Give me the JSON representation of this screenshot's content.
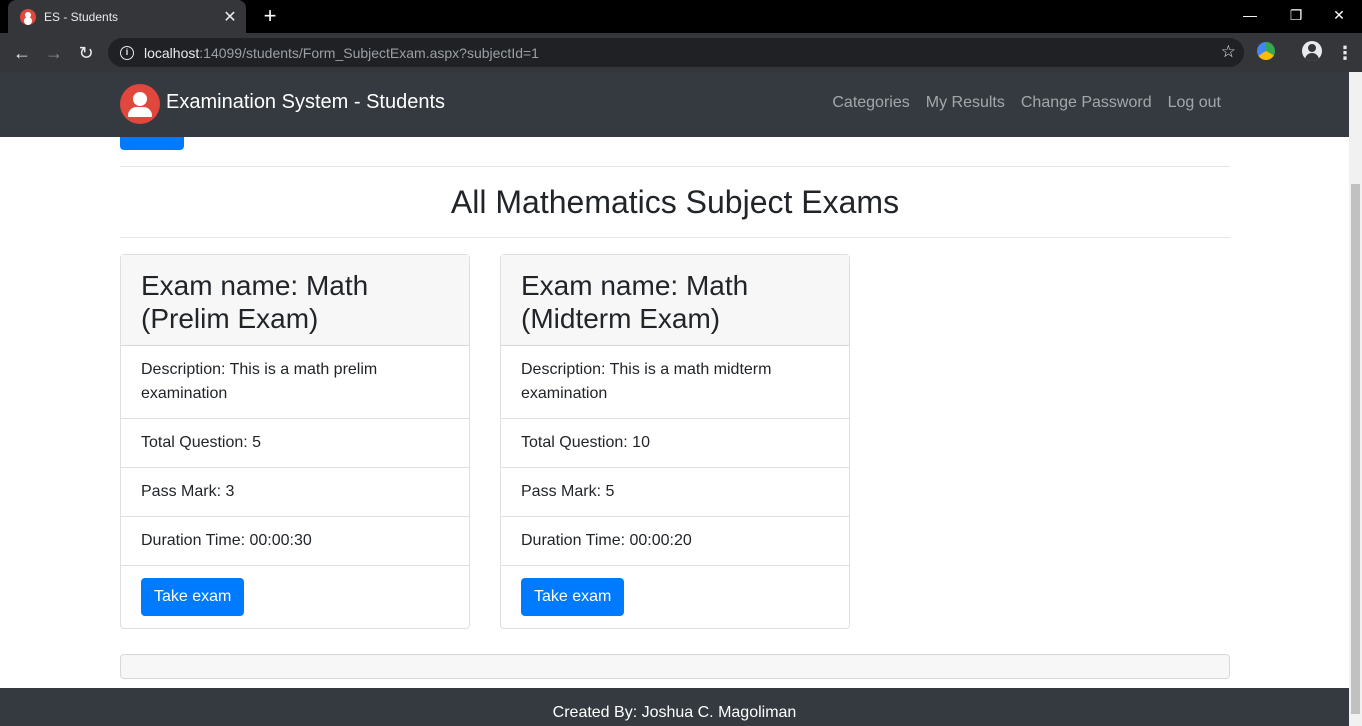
{
  "browser": {
    "tab_title": "ES - Students",
    "close_glyph": "✕",
    "new_tab_glyph": "+",
    "url_host": "localhost",
    "url_rest": ":14099/students/Form_SubjectExam.aspx?subjectId=1",
    "window_controls": {
      "minimize": "—",
      "restore": "❐",
      "close": "✕"
    }
  },
  "navbar": {
    "brand": "Examination System - Students",
    "links": [
      "Categories",
      "My Results",
      "Change Password",
      "Log out"
    ]
  },
  "page": {
    "title": "All Mathematics Subject Exams"
  },
  "exams": [
    {
      "name": "Exam name: Math (Prelim Exam)",
      "description": "Description: This is a math prelim examination",
      "total_questions": "Total Question: 5",
      "pass_mark": "Pass Mark: 3",
      "duration": "Duration Time: 00:00:30",
      "button": "Take exam"
    },
    {
      "name": "Exam name: Math (Midterm Exam)",
      "description": "Description: This is a math midterm examination",
      "total_questions": "Total Question: 10",
      "pass_mark": "Pass Mark: 5",
      "duration": "Duration Time: 00:00:20",
      "button": "Take exam"
    }
  ],
  "footer": {
    "credit": "Created By: Joshua C. Magoliman"
  },
  "colors": {
    "navbar": "#343a40",
    "primary": "#007bff",
    "logo": "#e0483d"
  }
}
